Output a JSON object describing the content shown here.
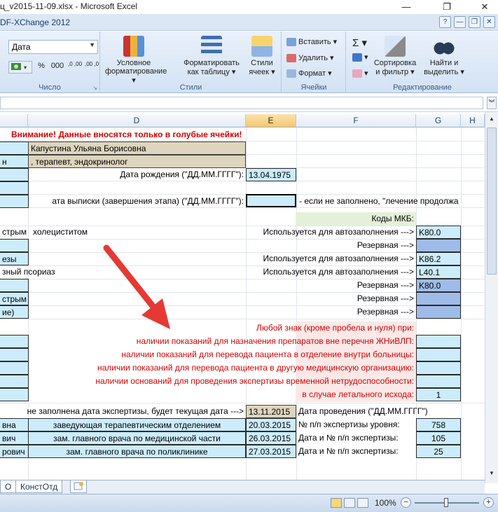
{
  "window": {
    "title": "ц_v2015-11-09.xlsx - Microsoft Excel",
    "min": "—",
    "restore": "❐",
    "close": "✕"
  },
  "ribbon_tab": "DF-XChange 2012",
  "ribbon": {
    "number_format_value": "Дата",
    "number_group_label": "Число",
    "percent_btn": "%",
    "thousands_btn": "000",
    "dec_inc_btn": ",0 ,00",
    "dec_dec_btn": ",00 ,0",
    "styles": {
      "label": "Стили",
      "conditional": [
        "Условное",
        "форматирование ▾"
      ],
      "as_table": [
        "Форматировать",
        "как таблицу ▾"
      ],
      "cell_styles": [
        "Стили",
        "ячеек ▾"
      ]
    },
    "cells": {
      "label": "Ячейки",
      "insert": "Вставить ▾",
      "delete": "Удалить ▾",
      "format": "Формат ▾"
    },
    "editing": {
      "label": "Редактирование",
      "sort": [
        "Сортировка",
        "и фильтр ▾"
      ],
      "find": [
        "Найти и",
        "выделить ▾"
      ]
    }
  },
  "columns": [
    "D",
    "E",
    "F",
    "G",
    "H"
  ],
  "sheet": {
    "r1_warning": "Внимание! Данные вносятся только в голубые ячейки!",
    "r2_name": "Капустина Ульяна Борисовна",
    "r3_role": ", терапевт, эндокринолог",
    "r3_left": "н",
    "r4_label": "Дата рождения (\"ДД.ММ.ГГГГ\"):",
    "r4_value": "13.04.1975",
    "r6_label": "ата выписки (завершения этапа) (\"ДД.ММ.ГГГГ\"):",
    "r6_note": "- если не заполнено, \"лечение продолжа",
    "r7_label": "Коды МКБ:",
    "r8_left": "стрым",
    "r8_text": "холециститом",
    "auto_label": "Используется для автозаполнения --->",
    "reserve_label": "Резервная --->",
    "r8_code": "K80.0",
    "r10_left": "езы",
    "r10_code": "K86.2",
    "r11_left": "зный псориаз",
    "r11_code": "L40.1",
    "r12_code": "K80.0",
    "r13_left": "стрым",
    "r14_left": "ие)",
    "flags": [
      "Любой знак (кроме пробела и нуля) при:",
      "наличии показаний для назначения препаратов вне перечня ЖНиВЛП:",
      "наличии показаний для перевода пациента в отделение внутри больницы:",
      "наличии показаний для перевода пациента в другую медицинскую организацию:",
      "наличии оснований для проведения экспертизы временной нетрудоспособности:",
      "в случае летального исхода:"
    ],
    "lethal_value": "1",
    "exam_note": "не заполнена дата экспертизы, будет текущая дата --->",
    "exam_date": "13.11.2015",
    "exam_label": "Дата проведения (\"ДД.ММ.ГГГГ\")",
    "experts": [
      {
        "left": "вна",
        "role": "заведующая терапевтическим отделением",
        "date": "20.03.2015",
        "label": "№ п/п экспертизы уровня:",
        "num": "758"
      },
      {
        "left": "вич",
        "role": "зам. главного врача по медицинской части",
        "date": "26.03.2015",
        "label": "Дата и № п/п экспертизы:",
        "num": "105"
      },
      {
        "left": "рович",
        "role": "зам. главного врача по поликлинике",
        "date": "27.03.2015",
        "label": "Дата и № п/п экспертизы:",
        "num": "25"
      }
    ]
  },
  "sheet_tabs": [
    "О",
    "КонстОтд"
  ],
  "status": {
    "zoom": "100%",
    "zoom_minus": "−",
    "zoom_plus": "+"
  },
  "colors": {
    "blue_cell": "#ccecfb",
    "tan_cell": "#ddd5bd",
    "purple_cell": "#9fbce8",
    "red_text": "#d10000",
    "arrow": "#e53935"
  }
}
